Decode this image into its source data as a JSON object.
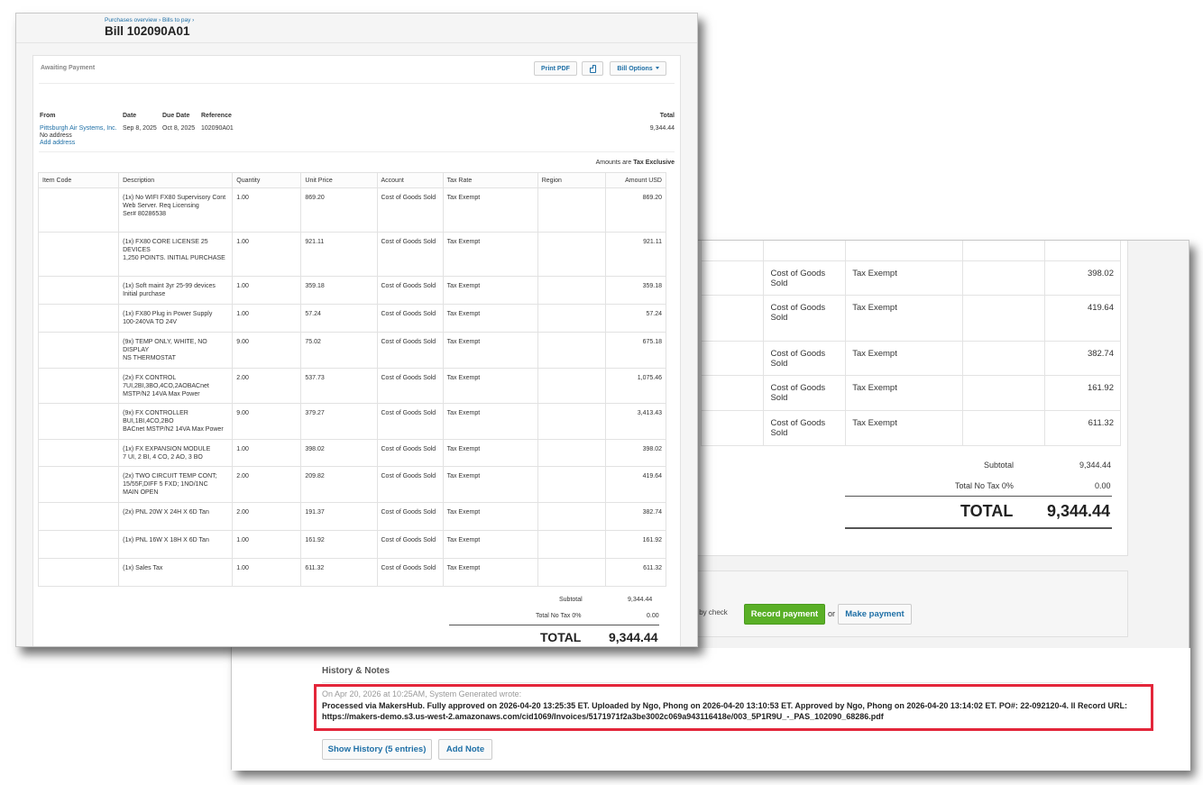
{
  "back": {
    "rows": [
      {
        "account": "Cost of Goods Sold",
        "tax": "Tax Exempt",
        "amount": "398.02"
      },
      {
        "account": "Cost of Goods Sold",
        "tax": "Tax Exempt",
        "amount": "419.64"
      },
      {
        "account": "Cost of Goods Sold",
        "tax": "Tax Exempt",
        "amount": "382.74"
      },
      {
        "account": "Cost of Goods Sold",
        "tax": "Tax Exempt",
        "amount": "161.92"
      },
      {
        "account": "Cost of Goods Sold",
        "tax": "Tax Exempt",
        "amount": "611.32"
      }
    ],
    "subtotal_label": "Subtotal",
    "subtotal_value": "9,344.44",
    "tax_label": "Total No Tax 0%",
    "tax_value": "0.00",
    "total_label": "TOTAL",
    "total_value": "9,344.44",
    "pay_text": "y by check",
    "record_payment": "Record payment",
    "or_text": "or",
    "make_payment": "Make payment",
    "history_title": "History & Notes",
    "history_meta": "On Apr 20, 2026 at 10:25AM, System Generated wrote:",
    "history_note": "Processed via MakersHub. Fully approved on 2026-04-20 13:25:35 ET. Uploaded by Ngo, Phong on 2026-04-20 13:10:53 ET. Approved by Ngo, Phong on 2026-04-20 13:14:02 ET. PO#: 22-092120-4. ll Record URL: https://makers-demo.s3.us-west-2.amazonaws.com/cid1069/Invoices/5171971f2a3be3002c069a943116418e/003_5P1R9U_-_PAS_102090_68286.pdf",
    "show_history": "Show History (5 entries)",
    "add_note": "Add Note",
    "highlight_color": "#e3263a",
    "record_btn_color": "#5ab027"
  },
  "front": {
    "breadcrumb": "Purchases overview › Bills to pay ›",
    "title": "Bill 102090A01",
    "status": "Awaiting Payment",
    "print_pdf": "Print PDF",
    "attach_icon": "file-icon",
    "bill_options": "Bill Options",
    "from_label": "From",
    "from_value": "Pittsburgh Air Systems, Inc.",
    "no_address": "No address",
    "add_address": "Add address",
    "date_label": "Date",
    "date_value": "Sep 8, 2025",
    "due_label": "Due Date",
    "due_value": "Oct 8, 2025",
    "ref_label": "Reference",
    "ref_value": "102090A01",
    "total_label": "Total",
    "total_value": "9,344.44",
    "amounts_are": "Amounts are",
    "tax_mode": "Tax Exclusive",
    "columns": [
      "Item Code",
      "Description",
      "Quantity",
      "Unit Price",
      "Account",
      "Tax Rate",
      "Region",
      "Amount USD"
    ],
    "rows": [
      {
        "code": "",
        "desc": "(1x) No WIFI FX80 Supervisory Cont\nWeb Server. Req Licensing\nSer# 80286538",
        "qty": "1.00",
        "price": "869.20",
        "account": "Cost of Goods Sold",
        "tax": "Tax Exempt",
        "region": "",
        "amount": "869.20"
      },
      {
        "code": "",
        "desc": "(1x) FX80 CORE LICENSE 25 DEVICES\n1,250 POINTS. INITIAL PURCHASE",
        "qty": "1.00",
        "price": "921.11",
        "account": "Cost of Goods Sold",
        "tax": "Tax Exempt",
        "region": "",
        "amount": "921.11"
      },
      {
        "code": "",
        "desc": "(1x) Soft maint 3yr 25-99 devices\nInitial purchase",
        "qty": "1.00",
        "price": "359.18",
        "account": "Cost of Goods Sold",
        "tax": "Tax Exempt",
        "region": "",
        "amount": "359.18"
      },
      {
        "code": "",
        "desc": "(1x) FX80 Plug in Power Supply\n100-240VA TO 24V",
        "qty": "1.00",
        "price": "57.24",
        "account": "Cost of Goods Sold",
        "tax": "Tax Exempt",
        "region": "",
        "amount": "57.24"
      },
      {
        "code": "",
        "desc": "(9x) TEMP ONLY, WHITE, NO DISPLAY\nNS THERMOSTAT",
        "qty": "9.00",
        "price": "75.02",
        "account": "Cost of Goods Sold",
        "tax": "Tax Exempt",
        "region": "",
        "amount": "675.18"
      },
      {
        "code": "",
        "desc": "(2x) FX CONTROL\n7UI,2BI,3BO,4CO,2AOBACnet\nMSTP/N2 14VA Max Power",
        "qty": "2.00",
        "price": "537.73",
        "account": "Cost of Goods Sold",
        "tax": "Tax Exempt",
        "region": "",
        "amount": "1,075.46"
      },
      {
        "code": "",
        "desc": "(9x) FX CONTROLLER\nBUI,1BI,4CO,2BO\nBACnet MSTP/N2 14VA Max Power",
        "qty": "9.00",
        "price": "379.27",
        "account": "Cost of Goods Sold",
        "tax": "Tax Exempt",
        "region": "",
        "amount": "3,413.43"
      },
      {
        "code": "",
        "desc": "(1x) FX EXPANSION MODULE\n7 UI, 2 BI, 4 CO, 2 AO, 3 BO",
        "qty": "1.00",
        "price": "398.02",
        "account": "Cost of Goods Sold",
        "tax": "Tax Exempt",
        "region": "",
        "amount": "398.02"
      },
      {
        "code": "",
        "desc": "(2x) TWO CIRCUIT TEMP CONT;\n15/55F,DIFF 5 FXD; 1NO/1NC\nMAIN OPEN",
        "qty": "2.00",
        "price": "209.82",
        "account": "Cost of Goods Sold",
        "tax": "Tax Exempt",
        "region": "",
        "amount": "419.64"
      },
      {
        "code": "",
        "desc": "(2x) PNL 20W X 24H X 6D Tan",
        "qty": "2.00",
        "price": "191.37",
        "account": "Cost of Goods Sold",
        "tax": "Tax Exempt",
        "region": "",
        "amount": "382.74"
      },
      {
        "code": "",
        "desc": "(1x) PNL 16W X 18H X 6D Tan",
        "qty": "1.00",
        "price": "161.92",
        "account": "Cost of Goods Sold",
        "tax": "Tax Exempt",
        "region": "",
        "amount": "161.92"
      },
      {
        "code": "",
        "desc": "(1x) Sales Tax",
        "qty": "1.00",
        "price": "611.32",
        "account": "Cost of Goods Sold",
        "tax": "Tax Exempt",
        "region": "",
        "amount": "611.32"
      }
    ],
    "subtotal_label": "Subtotal",
    "subtotal_value": "9,344.44",
    "tax_label": "Total No Tax 0%",
    "tax_value": "0.00",
    "grand_label": "TOTAL",
    "grand_value": "9,344.44"
  }
}
